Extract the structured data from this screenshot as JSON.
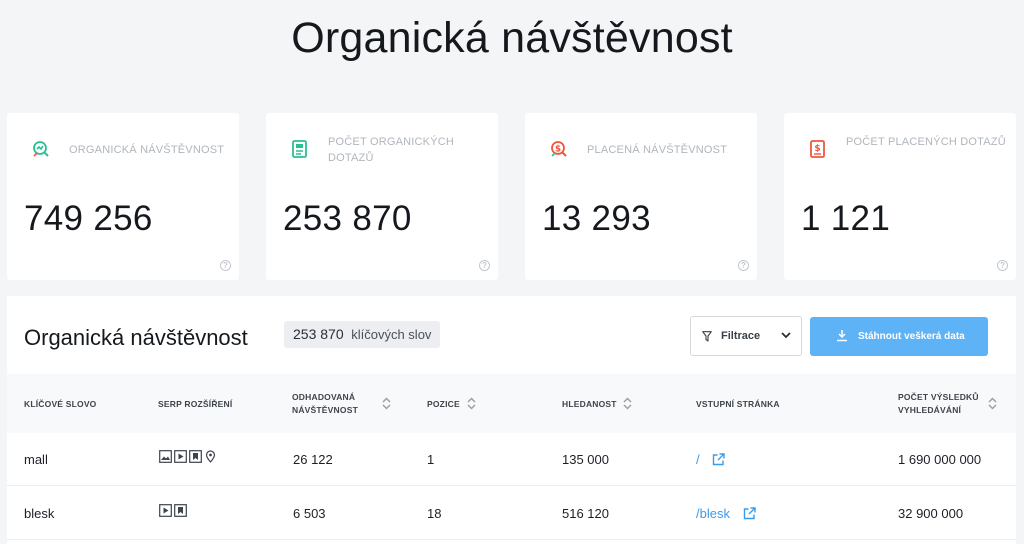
{
  "page_title": "Organická návštěvnost",
  "cards": [
    {
      "label": "ORGANICKÁ NÁVŠTĚVNOST",
      "value": "749 256",
      "icon": "organic-traffic-icon",
      "accent": "#2bbf95"
    },
    {
      "label": "POČET ORGANICKÝCH DOTAZŮ",
      "value": "253 870",
      "icon": "organic-queries-icon",
      "accent": "#2bbf95"
    },
    {
      "label": "PLACENÁ NÁVŠTĚVNOST",
      "value": "13 293",
      "icon": "paid-traffic-icon",
      "accent": "#f0553e"
    },
    {
      "label": "POČET PLACENÝCH DOTAZŮ",
      "value": "1 121",
      "icon": "paid-queries-icon",
      "accent": "#f0553e"
    }
  ],
  "help_glyph": "?",
  "panel": {
    "title": "Organická návštěvnost",
    "badge_count": "253 870",
    "badge_label": "klíčových slov",
    "filter_label": "Filtrace",
    "download_label": "Stáhnout veškerá data"
  },
  "table": {
    "columns": [
      "KLÍČOVÉ SLOVO",
      "SERP ROZŠÍŘENÍ",
      "ODHADOVANÁ NÁVŠTĚVNOST",
      "POZICE",
      "HLEDANOST",
      "VSTUPNÍ STRÁNKA",
      "POČET VÝSLEDKŮ VYHLEDÁVÁNÍ"
    ],
    "rows": [
      {
        "keyword": "mall",
        "serp": [
          "image-icon",
          "video-icon",
          "bookmark-icon",
          "location-icon"
        ],
        "traffic": "26 122",
        "position": "1",
        "volume": "135 000",
        "landing": "/",
        "results": "1 690 000 000"
      },
      {
        "keyword": "blesk",
        "serp": [
          "video-icon",
          "bookmark-icon"
        ],
        "traffic": "6 503",
        "position": "18",
        "volume": "516 120",
        "landing": "/blesk",
        "results": "32 900 000"
      }
    ]
  },
  "colors": {
    "accent_blue": "#5db3f5",
    "link": "#3c9be8",
    "green": "#2bbf95",
    "red": "#f0553e"
  }
}
